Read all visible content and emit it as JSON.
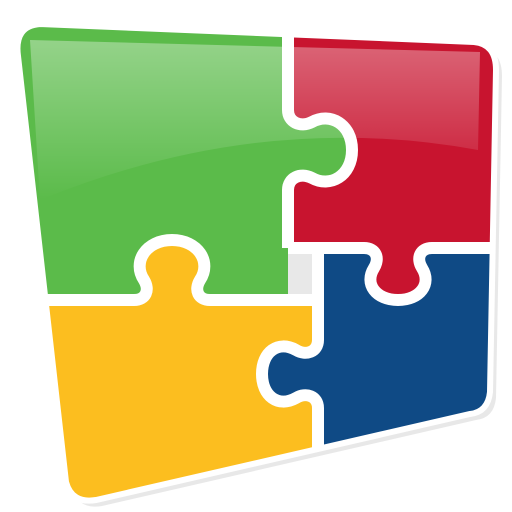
{
  "logo": {
    "name": "puzzle-logo",
    "pieces": [
      {
        "id": "green",
        "color": "#5BBB4A",
        "highlight": "#7FD06C"
      },
      {
        "id": "red",
        "color": "#C8142F",
        "highlight": "#D9455A"
      },
      {
        "id": "yellow",
        "color": "#FCBE1F",
        "highlight": "#FDD05A"
      },
      {
        "id": "blue",
        "color": "#0F4A85",
        "highlight": "#2C6AA5"
      }
    ],
    "outline_color": "#FFFFFF",
    "shadow_color": "#C9C9C9"
  }
}
